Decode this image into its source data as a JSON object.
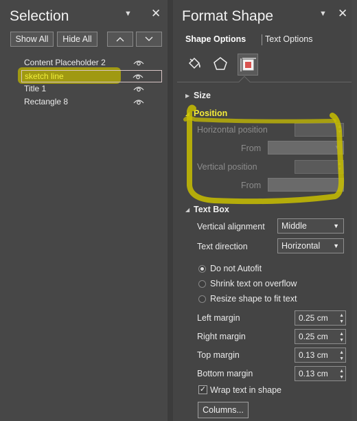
{
  "colors": {
    "highlight": "#f5ee3a",
    "marker": "#c8be00",
    "background": "#474747"
  },
  "selection": {
    "title": "Selection",
    "show_all": "Show All",
    "hide_all": "Hide All",
    "items": [
      {
        "label": "Content Placeholder 2",
        "icon": "eye-icon"
      },
      {
        "label": "sketch line",
        "icon": "eye-icon",
        "selected": true
      },
      {
        "label": "Title 1",
        "icon": "eye-icon"
      },
      {
        "label": "Rectangle 8",
        "icon": "eye-icon"
      }
    ]
  },
  "format": {
    "title": "Format Shape",
    "tabs": {
      "shape": "Shape Options",
      "text": "Text Options"
    },
    "icons": [
      "fill-line-icon",
      "effects-pentagon-icon",
      "size-properties-icon"
    ],
    "sections": {
      "size": "Size",
      "position": "Position",
      "textbox": "Text Box"
    },
    "position": {
      "h_label": "Horizontal position",
      "h_from": "From",
      "v_label": "Vertical position",
      "v_from": "From"
    },
    "textbox": {
      "valign_label": "Vertical alignment",
      "valign_value": "Middle",
      "dir_label": "Text direction",
      "dir_value": "Horizontal",
      "radios": [
        "Do not Autofit",
        "Shrink text on overflow",
        "Resize shape to fit text"
      ],
      "selected_radio": 0,
      "margins": [
        {
          "label": "Left margin",
          "value": "0.25 cm"
        },
        {
          "label": "Right margin",
          "value": "0.25 cm"
        },
        {
          "label": "Top margin",
          "value": "0.13 cm"
        },
        {
          "label": "Bottom margin",
          "value": "0.13 cm"
        }
      ],
      "wrap_label": "Wrap text in shape",
      "wrap_checked": true,
      "columns_button": "Columns..."
    }
  }
}
